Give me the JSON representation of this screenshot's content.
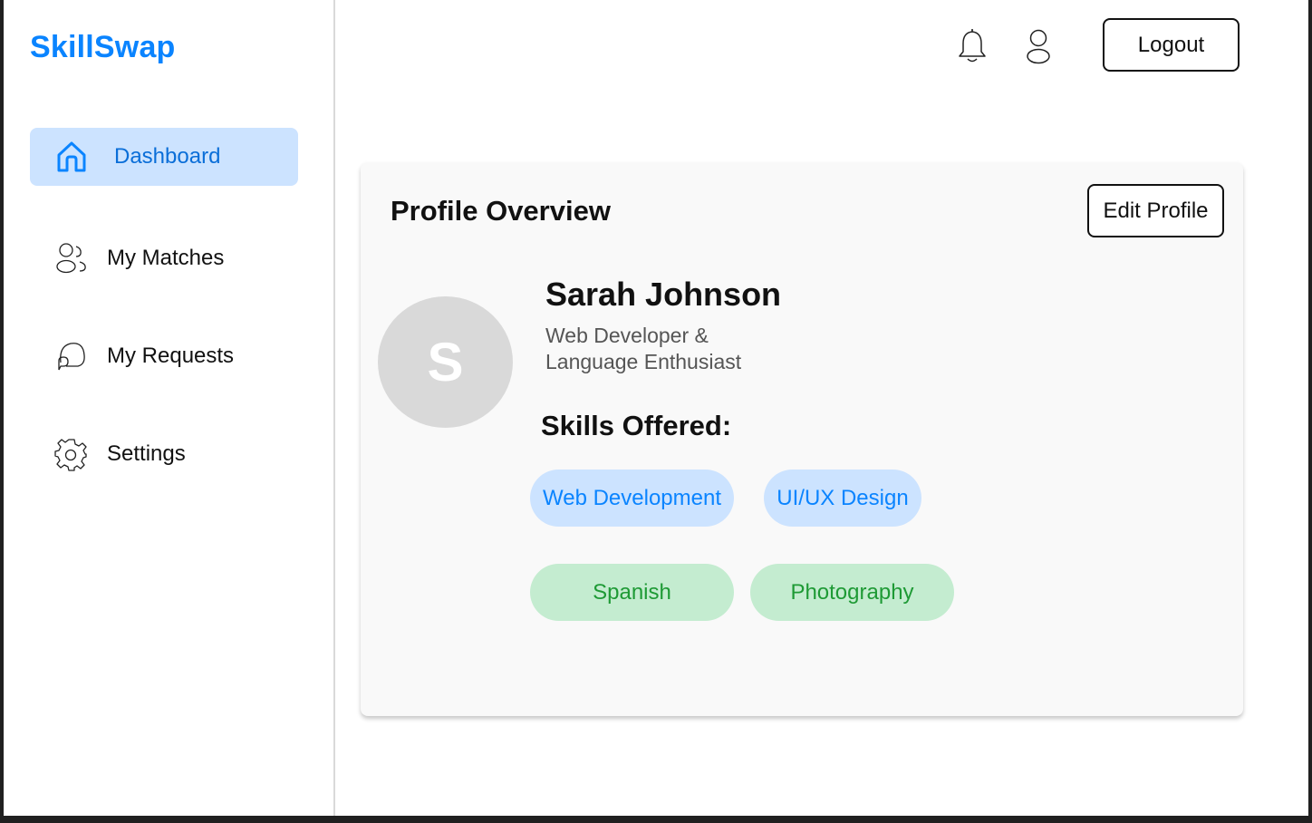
{
  "app": {
    "brand": "SkillSwap"
  },
  "sidebar": {
    "items": [
      {
        "label": "Dashboard",
        "icon": "home-icon",
        "active": true
      },
      {
        "label": "My Matches",
        "icon": "users-icon",
        "active": false
      },
      {
        "label": "My Requests",
        "icon": "chat-bubbles-icon",
        "active": false
      },
      {
        "label": "Settings",
        "icon": "gear-icon",
        "active": false
      }
    ]
  },
  "header": {
    "notification_icon": "bell-icon",
    "profile_icon": "user-icon",
    "logout_label": "Logout"
  },
  "profile_card": {
    "title": "Profile Overview",
    "edit_label": "Edit Profile",
    "avatar_initial": "S",
    "name": "Sarah Johnson",
    "bio_line1": "Web Developer &",
    "bio_line2": "Language Enthusiast",
    "skills_title": "Skills Offered:",
    "skills": [
      {
        "label": "Web Development",
        "color": "#0a84ff",
        "bg": "#cce3ff"
      },
      {
        "label": "UI/UX Design",
        "color": "#0a84ff",
        "bg": "#cce3ff"
      },
      {
        "label": "Spanish",
        "color": "#1e9a35",
        "bg": "#c4ecd0"
      },
      {
        "label": "Photography",
        "color": "#1e9a35",
        "bg": "#c4ecd0"
      }
    ]
  },
  "colors": {
    "accent": "#0a84ff",
    "active_nav_bg": "#cce3ff",
    "green_chip_bg": "#c4ecd0",
    "green_chip_text": "#1e9a35"
  }
}
